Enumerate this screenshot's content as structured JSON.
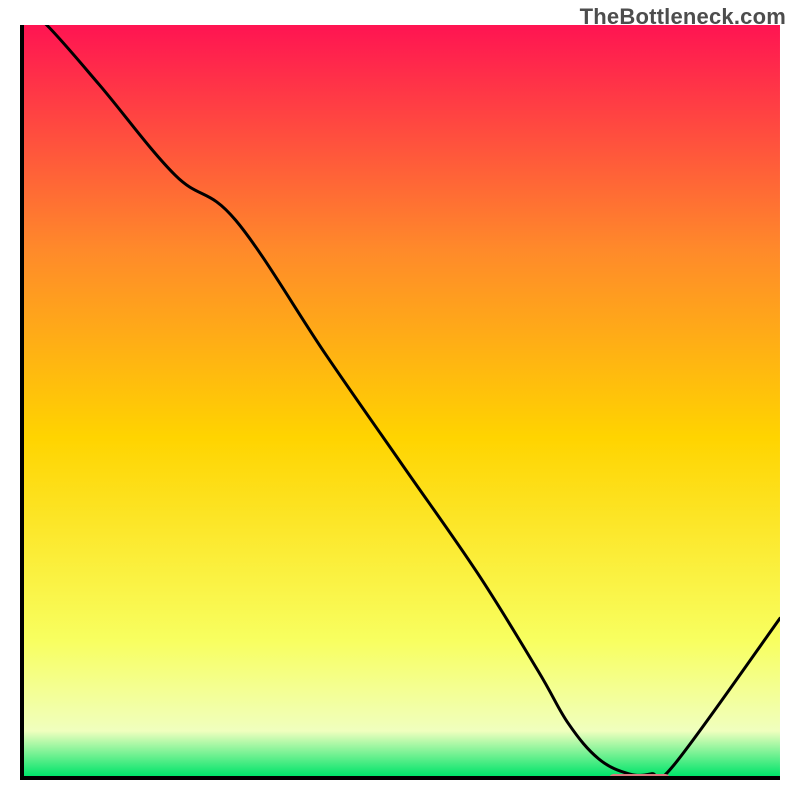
{
  "watermark": "TheBottleneck.com",
  "colors": {
    "gradient_top": "#ff1452",
    "gradient_mid_upper": "#ff8a2a",
    "gradient_mid": "#ffd400",
    "gradient_lower": "#f8ff60",
    "gradient_pale": "#f0ffbe",
    "gradient_bottom": "#00e46a",
    "curve": "#000000",
    "marker": "#d87a7e",
    "axis": "#000000"
  },
  "chart_data": {
    "type": "line",
    "title": "",
    "xlabel": "",
    "ylabel": "",
    "xlim": [
      0,
      100
    ],
    "ylim": [
      0,
      100
    ],
    "grid": false,
    "legend": false,
    "x": [
      0,
      3,
      10,
      20,
      28,
      40,
      50,
      60,
      68,
      72,
      76,
      80,
      83,
      86,
      100
    ],
    "values": [
      102,
      100,
      92,
      80,
      74,
      56,
      41.5,
      27,
      14,
      7,
      2.3,
      0.3,
      0.3,
      1.5,
      21
    ],
    "flat_region": {
      "x_start": 77,
      "x_end": 85,
      "y": 0.3
    },
    "annotations": [
      {
        "text": "TheBottleneck.com",
        "position": "top-right"
      }
    ]
  }
}
